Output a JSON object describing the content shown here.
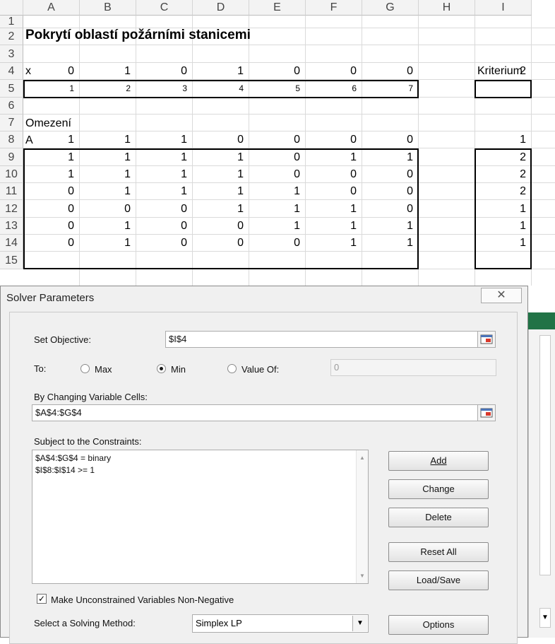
{
  "sheet": {
    "columns": [
      "A",
      "B",
      "C",
      "D",
      "E",
      "F",
      "G",
      "H",
      "I"
    ],
    "rows": [
      "1",
      "2",
      "3",
      "4",
      "5",
      "6",
      "7",
      "8",
      "9",
      "10",
      "11",
      "12",
      "13",
      "14",
      "15"
    ],
    "title": "Pokrytí oblastí požárními stanicemi",
    "x_label": "x",
    "kriterium_label": "Kriterium",
    "x_values": [
      "0",
      "1",
      "0",
      "1",
      "0",
      "0",
      "0"
    ],
    "criterion_value": "2",
    "indices": [
      "1",
      "2",
      "3",
      "4",
      "5",
      "6",
      "7"
    ],
    "omezeni_label": "Omezení",
    "a_label": "A",
    "matrix": [
      [
        "1",
        "1",
        "1",
        "0",
        "0",
        "0",
        "0"
      ],
      [
        "1",
        "1",
        "1",
        "1",
        "0",
        "1",
        "1"
      ],
      [
        "1",
        "1",
        "1",
        "1",
        "0",
        "0",
        "0"
      ],
      [
        "0",
        "1",
        "1",
        "1",
        "1",
        "0",
        "0"
      ],
      [
        "0",
        "0",
        "0",
        "1",
        "1",
        "1",
        "0"
      ],
      [
        "0",
        "1",
        "0",
        "0",
        "1",
        "1",
        "1"
      ],
      [
        "0",
        "1",
        "0",
        "0",
        "0",
        "1",
        "1"
      ]
    ],
    "column_i_values": [
      "1",
      "2",
      "2",
      "2",
      "1",
      "1",
      "1"
    ]
  },
  "dialog": {
    "title": "Solver Parameters",
    "close_glyph": "✕",
    "set_objective_label": "Set Objective:",
    "objective_value": "$I$4",
    "to_label": "To:",
    "max_label": "Max",
    "min_label": "Min",
    "value_of_label": "Value Of:",
    "value_of_value": "0",
    "selected_goal": "Min",
    "changing_cells_label": "By Changing Variable Cells:",
    "changing_cells_value": "$A$4:$G$4",
    "constraints_label": "Subject to the Constraints:",
    "constraints": [
      "$A$4:$G$4 = binary",
      "$I$8:$I$14 >= 1"
    ],
    "buttons": {
      "add": "Add",
      "change": "Change",
      "delete": "Delete",
      "reset_all": "Reset All",
      "load_save": "Load/Save",
      "options": "Options"
    },
    "nonneg_label": "Make Unconstrained Variables Non-Negative",
    "nonneg_checked": true,
    "method_label": "Select a Solving Method:",
    "method_value": "Simplex LP"
  },
  "colors": {
    "accent_green": "#217346"
  }
}
